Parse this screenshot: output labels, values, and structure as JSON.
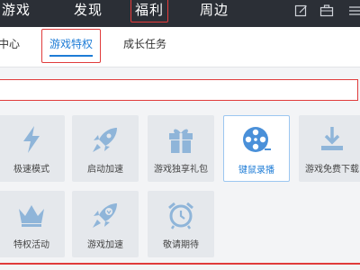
{
  "nav": {
    "items": [
      {
        "label": "游戏"
      },
      {
        "label": "发现"
      },
      {
        "label": "福利"
      },
      {
        "label": "周边"
      }
    ]
  },
  "tabs": [
    {
      "label": "中心"
    },
    {
      "label": "游戏特权"
    },
    {
      "label": "成长任务"
    }
  ],
  "tiles": [
    {
      "label": "极速模式",
      "icon": "lightning-icon"
    },
    {
      "label": "启动加速",
      "icon": "rocket-icon"
    },
    {
      "label": "游戏独享礼包",
      "icon": "gift-icon"
    },
    {
      "label": "键鼠录播",
      "icon": "film-reel-icon"
    },
    {
      "label": "游戏免费下载",
      "icon": "download-icon"
    },
    {
      "label": "特权活动",
      "icon": "crown-icon"
    },
    {
      "label": "游戏加速",
      "icon": "rocket-badge-icon"
    },
    {
      "label": "敬请期待",
      "icon": "alarm-clock-icon"
    }
  ],
  "colors": {
    "accent": "#1e7cd6",
    "icon": "#8fb5d9",
    "highlight": "#e03b3b"
  }
}
